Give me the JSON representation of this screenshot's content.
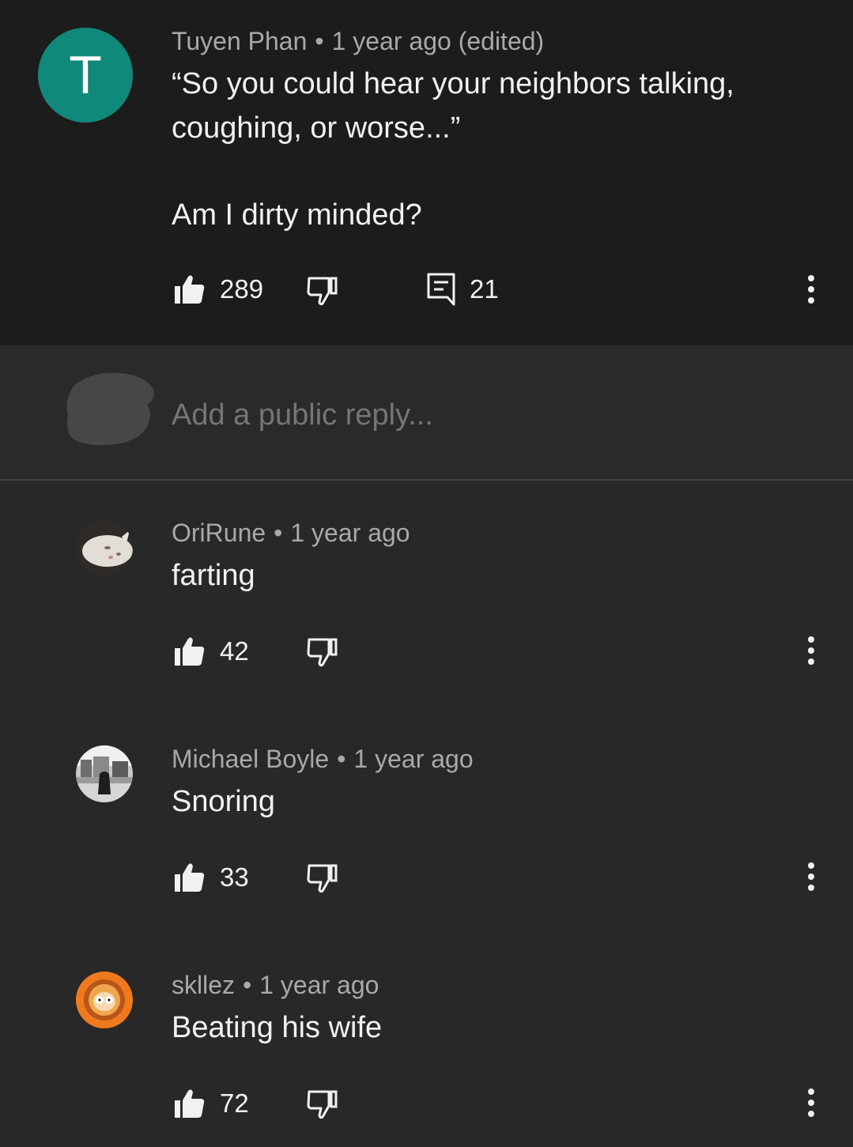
{
  "comment": {
    "author": "Tuyen Phan",
    "separator": "•",
    "time": "1 year ago (edited)",
    "avatar_letter": "T",
    "text_line1": "“So you could hear your neighbors talking,",
    "text_line2": "coughing, or worse...”",
    "text_line3": "Am I dirty minded?",
    "likes": "289",
    "replies_count": "21",
    "avatar_color": "#11897a"
  },
  "reply_box": {
    "placeholder": "Add a public reply..."
  },
  "replies": [
    {
      "author": "OriRune",
      "time": "1 year ago",
      "text": "farting",
      "likes": "42"
    },
    {
      "author": "Michael Boyle",
      "time": "1 year ago",
      "text": "Snoring",
      "likes": "33"
    },
    {
      "author": "skllez",
      "time": "1 year ago",
      "text": "Beating his wife",
      "likes": "72"
    }
  ],
  "icons": {
    "like": "thumbs-up-icon",
    "dislike": "thumbs-down-icon",
    "reply": "comment-icon",
    "more": "more-vertical-icon"
  }
}
